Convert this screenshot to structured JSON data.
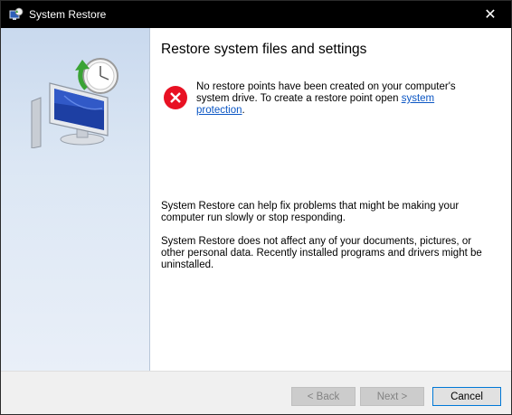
{
  "window": {
    "title": "System Restore",
    "close_glyph": "✕"
  },
  "icons": {
    "app": "system-restore-icon",
    "hero": "system-restore-monitor-clock-icon",
    "error": "error-icon"
  },
  "colors": {
    "titlebar": "#000000",
    "sidebar": "#d4e1f1",
    "link": "#0b56c4",
    "error_red": "#e81123"
  },
  "main": {
    "heading": "Restore system files and settings",
    "error_message_before_link": "No restore points have been created on your computer's system drive. To create a restore point open ",
    "error_link": "system protection",
    "error_message_after_link": ".",
    "para1": "System Restore can help fix problems that might be making your computer run slowly or stop responding.",
    "para2": "System Restore does not affect any of your documents, pictures, or other personal data. Recently installed programs and drivers might be uninstalled."
  },
  "buttons": {
    "back": "< Back",
    "next": "Next >",
    "cancel": "Cancel"
  }
}
